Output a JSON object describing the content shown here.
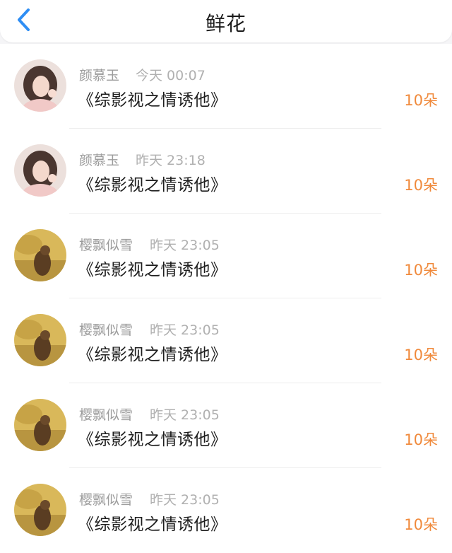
{
  "header": {
    "title": "鲜花",
    "back_icon": "chevron-left-icon",
    "accent": "#2f8ef4"
  },
  "rows": [
    {
      "name": "颜慕玉",
      "time": "今天 00:07",
      "book": "《综影视之情诱他》",
      "amount": "10朵",
      "avatar": "portrait-avatar"
    },
    {
      "name": "颜慕玉",
      "time": "昨天 23:18",
      "book": "《综影视之情诱他》",
      "amount": "10朵",
      "avatar": "portrait-avatar"
    },
    {
      "name": "樱飘似雪",
      "time": "昨天 23:05",
      "book": "《综影视之情诱他》",
      "amount": "10朵",
      "avatar": "scenery-avatar"
    },
    {
      "name": "樱飘似雪",
      "time": "昨天 23:05",
      "book": "《综影视之情诱他》",
      "amount": "10朵",
      "avatar": "scenery-avatar"
    },
    {
      "name": "樱飘似雪",
      "time": "昨天 23:05",
      "book": "《综影视之情诱他》",
      "amount": "10朵",
      "avatar": "scenery-avatar"
    },
    {
      "name": "樱飘似雪",
      "time": "昨天 23:05",
      "book": "《综影视之情诱他》",
      "amount": "10朵",
      "avatar": "scenery-avatar"
    }
  ],
  "colors": {
    "amount": "#f08a3c",
    "name": "#9c9c9c",
    "book": "#1e1e1e"
  }
}
